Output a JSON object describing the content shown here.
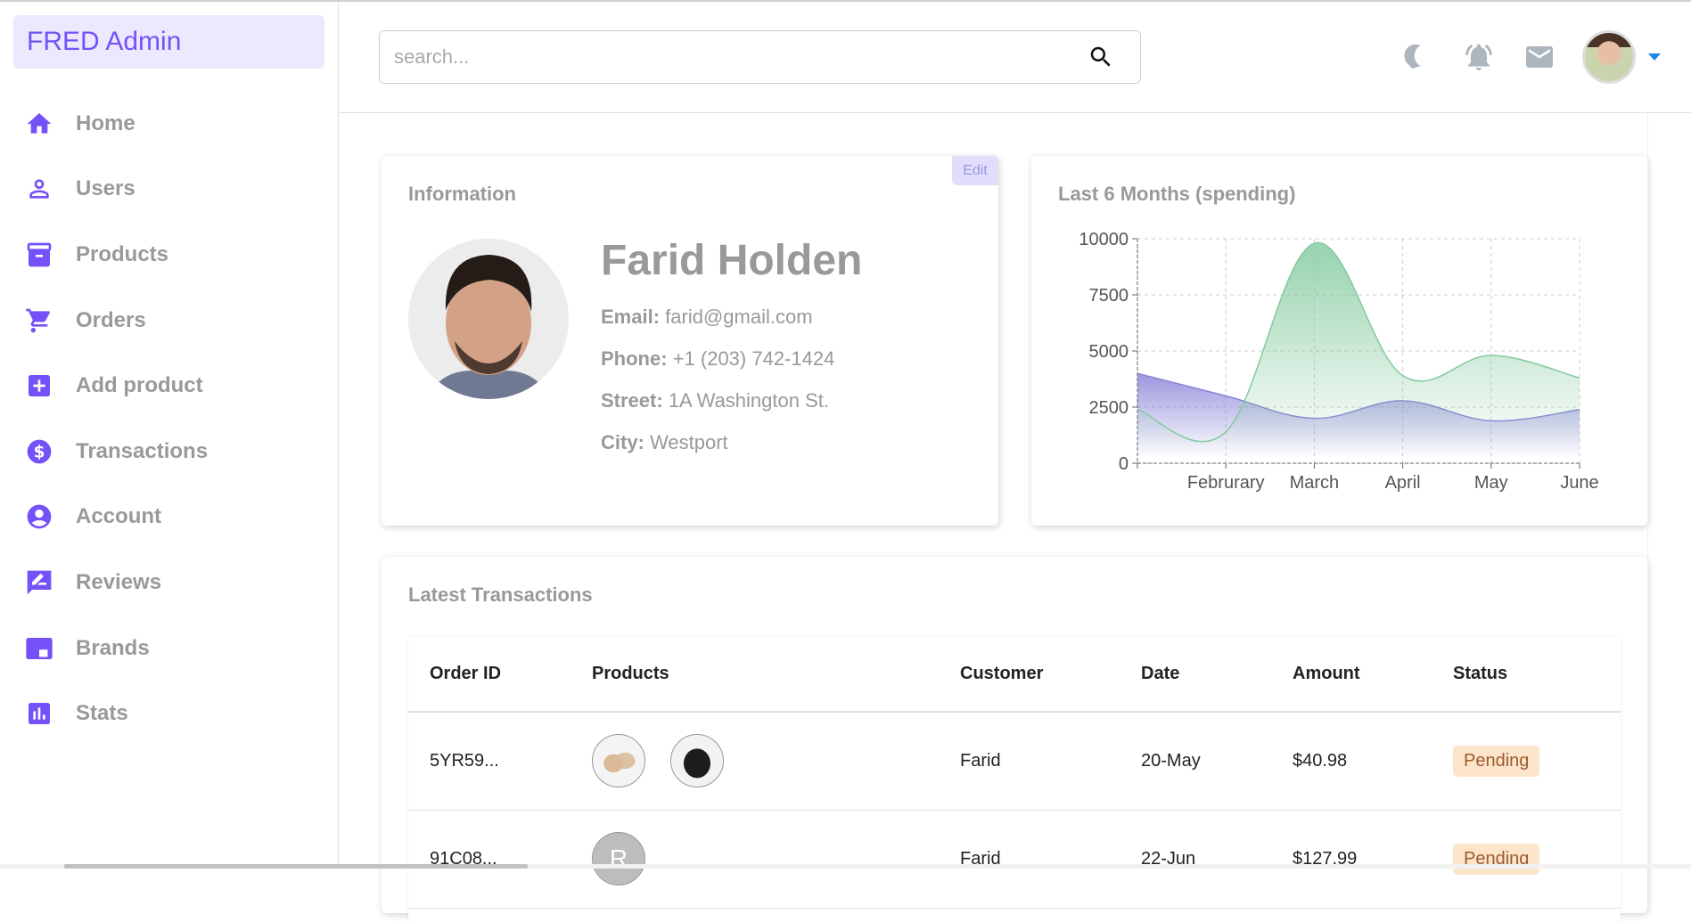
{
  "app": {
    "title": "FRED Admin",
    "accent": "#7451f8"
  },
  "sidebar": {
    "items": [
      {
        "label": "Home",
        "icon": "home-icon"
      },
      {
        "label": "Users",
        "icon": "user-icon"
      },
      {
        "label": "Products",
        "icon": "archive-icon"
      },
      {
        "label": "Orders",
        "icon": "cart-icon"
      },
      {
        "label": "Add product",
        "icon": "add-box-icon"
      },
      {
        "label": "Transactions",
        "icon": "dollar-icon"
      },
      {
        "label": "Account",
        "icon": "account-circle-icon"
      },
      {
        "label": "Reviews",
        "icon": "rate-review-icon"
      },
      {
        "label": "Brands",
        "icon": "picture-in-picture-icon"
      },
      {
        "label": "Stats",
        "icon": "bar-chart-icon"
      }
    ]
  },
  "header": {
    "search": {
      "placeholder": "search...",
      "value": ""
    },
    "icons": [
      "dark-mode-icon",
      "notifications-icon",
      "mail-icon"
    ]
  },
  "info": {
    "title": "Information",
    "edit_label": "Edit",
    "name": "Farid Holden",
    "fields": [
      {
        "label": "Email:",
        "value": "farid@gmail.com"
      },
      {
        "label": "Phone:",
        "value": "+1 (203) 742-1424"
      },
      {
        "label": "Street:",
        "value": "1A Washington St."
      },
      {
        "label": "City:",
        "value": "Westport"
      }
    ]
  },
  "chart": {
    "title": "Last 6 Months (spending)"
  },
  "chart_data": {
    "type": "area",
    "title": "Last 6 Months (spending)",
    "categories": [
      "",
      "Februrary",
      "March",
      "April",
      "May",
      "June"
    ],
    "series": [
      {
        "name": "series-purple",
        "color": "#8884d8",
        "values": [
          4000,
          3000,
          2000,
          2780,
          1890,
          2390
        ]
      },
      {
        "name": "series-green",
        "color": "#82ca9d",
        "values": [
          2400,
          1398,
          9800,
          3908,
          4800,
          3800
        ]
      }
    ],
    "yticks": [
      0,
      2500,
      5000,
      7500,
      10000
    ],
    "ylim": [
      0,
      10000
    ],
    "grid": true,
    "xlabel": "",
    "ylabel": ""
  },
  "transactions": {
    "title": "Latest Transactions",
    "columns": [
      "Order ID",
      "Products",
      "Customer",
      "Date",
      "Amount",
      "Status"
    ],
    "rows": [
      {
        "order_id": "5YR59...",
        "products": [
          "sandals",
          "backpack"
        ],
        "customer": "Farid",
        "date": "20-May",
        "amount": "$40.98",
        "status": "Pending"
      },
      {
        "order_id": "91C08...",
        "products": [
          "R"
        ],
        "customer": "Farid",
        "date": "22-Jun",
        "amount": "$127.99",
        "status": "Pending"
      }
    ]
  }
}
